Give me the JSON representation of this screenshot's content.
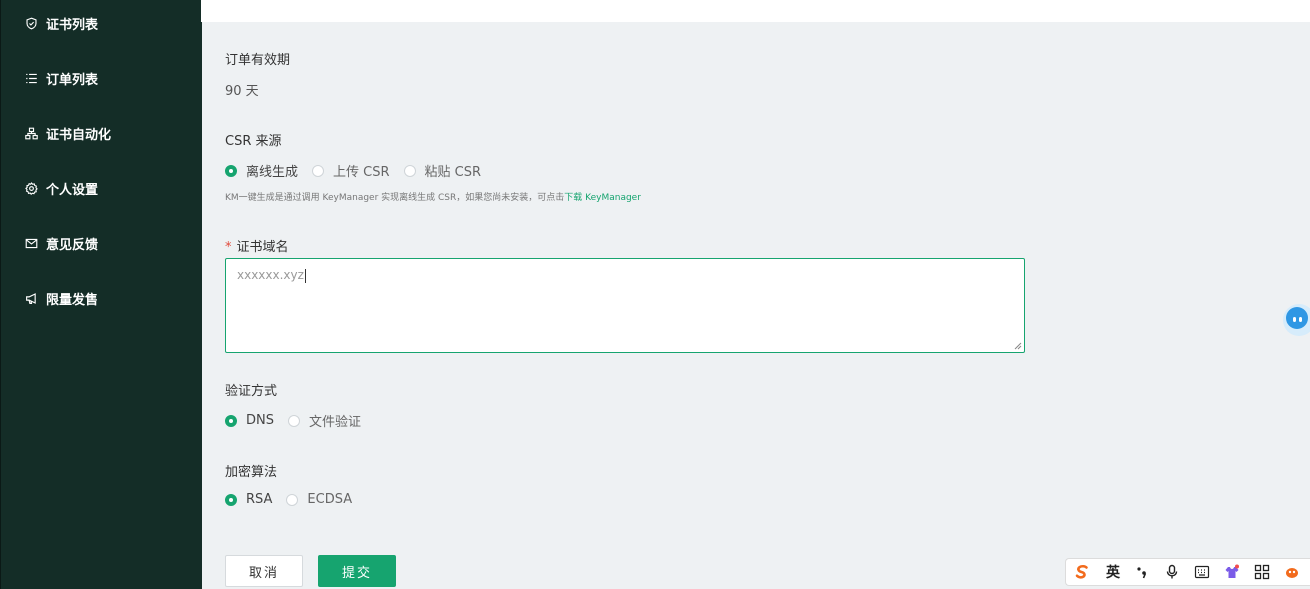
{
  "sidebar": {
    "items": [
      {
        "label": "证书列表",
        "icon": "shield-check-icon"
      },
      {
        "label": "订单列表",
        "icon": "list-icon"
      },
      {
        "label": "证书自动化",
        "icon": "hierarchy-icon"
      },
      {
        "label": "个人设置",
        "icon": "gear-icon"
      },
      {
        "label": "意见反馈",
        "icon": "mail-icon"
      },
      {
        "label": "限量发售",
        "icon": "megaphone-icon"
      }
    ]
  },
  "form": {
    "validity": {
      "label": "订单有效期",
      "value": "90 天"
    },
    "csr": {
      "label": "CSR 来源",
      "options": [
        "离线生成",
        "上传 CSR",
        "粘贴 CSR"
      ],
      "selected": "离线生成",
      "hint_text": "KM一键生成是通过调用 KeyManager 实现离线生成 CSR，如果您尚未安装，可点击",
      "hint_link": "下载 KeyManager"
    },
    "domain": {
      "required_mark": "*",
      "label": "证书域名",
      "value": "xxxxxx.xyz"
    },
    "verify": {
      "label": "验证方式",
      "options": [
        "DNS",
        "文件验证"
      ],
      "selected": "DNS"
    },
    "algo": {
      "label": "加密算法",
      "options": [
        "RSA",
        "ECDSA"
      ],
      "selected": "RSA"
    },
    "cancel_label": "取消",
    "submit_label": "提交"
  },
  "ime_toolbar": {
    "mode_label": "英"
  },
  "colors": {
    "sidebar_bg": "#142d27",
    "accent": "#16a46f",
    "page_bg": "#eef1f3"
  }
}
